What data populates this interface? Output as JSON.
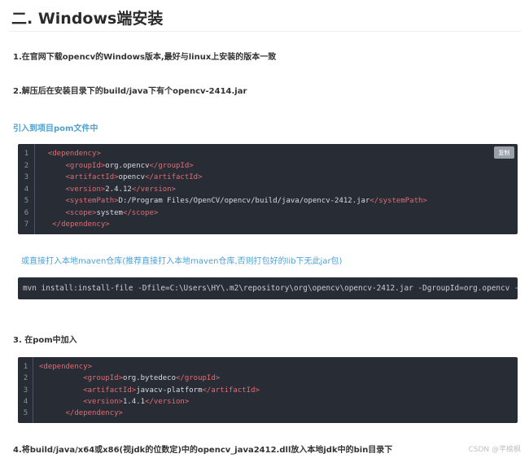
{
  "title": "二. Windows端安装",
  "step1": "1.在官网下载opencv的Windows版本,最好与linux上安装的版本一致",
  "step2": "2.解压后在安装目录下的build/java下有个opencv-2414.jar",
  "pom_link": "引入到项目pom文件中",
  "copy_label": "复制",
  "block1": {
    "line_numbers": [
      "1",
      "2",
      "3",
      "4",
      "5",
      "6",
      "7"
    ],
    "lines": [
      {
        "indent": "  ",
        "open": "<dependency>",
        "text": "",
        "close": ""
      },
      {
        "indent": "      ",
        "open": "<groupId>",
        "text": "org.opencv",
        "close": "</groupId>"
      },
      {
        "indent": "      ",
        "open": "<artifactId>",
        "text": "opencv",
        "close": "</artifactId>"
      },
      {
        "indent": "      ",
        "open": "<version>",
        "text": "2.4.12",
        "close": "</version>"
      },
      {
        "indent": "      ",
        "open": "<systemPath>",
        "text": "D:/Program Files/OpenCV/opencv/build/java/opencv-2412.jar",
        "close": "</systemPath>"
      },
      {
        "indent": "      ",
        "open": "<scope>",
        "text": "system",
        "close": "</scope>"
      },
      {
        "indent": "   ",
        "open": "</dependency>",
        "text": "",
        "close": ""
      }
    ]
  },
  "maven_note": "或直接打入本地maven仓库(推荐直接打入本地maven仓库,否则打包好的lib下无此jar包)",
  "mvn_command": "mvn install:install-file -Dfile=C:\\Users\\HY\\.m2\\repository\\org\\opencv\\opencv-2412.jar -DgroupId=org.opencv -",
  "step3": "3. 在pom中加入",
  "block2": {
    "line_numbers": [
      "1",
      "2",
      "3",
      "4",
      "5"
    ],
    "lines": [
      {
        "indent": "",
        "open": "<dependency>",
        "text": "",
        "close": ""
      },
      {
        "indent": "          ",
        "open": "<groupId>",
        "text": "org.bytedeco",
        "close": "</groupId>"
      },
      {
        "indent": "          ",
        "open": "<artifactId>",
        "text": "javacv-platform",
        "close": "</artifactId>"
      },
      {
        "indent": "          ",
        "open": "<version>",
        "text": "1.4.1",
        "close": "</version>"
      },
      {
        "indent": "      ",
        "open": "</dependency>",
        "text": "",
        "close": ""
      }
    ]
  },
  "step4": "4.将build/java/x64或x86(视jdk的位数定)中的opencv_java2412.dll放入本地jdk中的bin目录下",
  "watermark": "CSDN @芊榆枫"
}
